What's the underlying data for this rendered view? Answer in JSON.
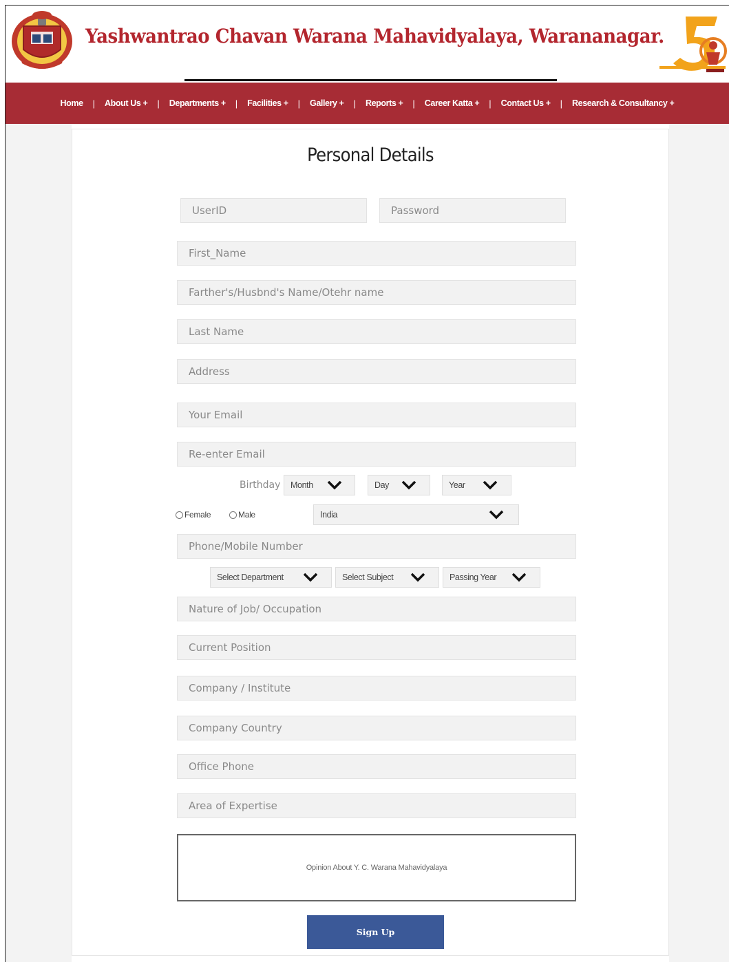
{
  "header": {
    "title": "Yashwantrao Chavan Warana Mahavidyalaya, Warananagar.",
    "colors": {
      "brand_red": "#a72c35",
      "title_red": "#b3262e",
      "button_blue": "#3b5998"
    }
  },
  "nav": {
    "items": [
      {
        "label": "Home"
      },
      {
        "label": "About Us +"
      },
      {
        "label": "Departments +"
      },
      {
        "label": "Facilities +"
      },
      {
        "label": "Gallery +"
      },
      {
        "label": "Reports +"
      },
      {
        "label": "Career Katta +"
      },
      {
        "label": "Contact Us +"
      },
      {
        "label": "Research & Consultancy +"
      }
    ],
    "separator": "|"
  },
  "form": {
    "title": "Personal Details",
    "userid_placeholder": "UserID",
    "password_placeholder": "Password",
    "first_name_placeholder": "First_Name",
    "middle_name_placeholder": "Farther's/Husbnd's Name/Otehr name",
    "last_name_placeholder": "Last Name",
    "address_placeholder": "Address",
    "email_placeholder": "Your Email",
    "reemail_placeholder": "Re-enter Email",
    "birthday_label": "Birthday",
    "month_select": "Month",
    "day_select": "Day",
    "year_select": "Year",
    "gender_female": "Female",
    "gender_male": "Male",
    "country_select": "India",
    "phone_placeholder": "Phone/Mobile Number",
    "department_select": "Select Department",
    "subject_select": "Select Subject",
    "passing_year_select": "Passing Year",
    "occupation_placeholder": "Nature of Job/ Occupation",
    "position_placeholder": "Current Position",
    "company_placeholder": "Company / Institute",
    "company_country_placeholder": "Company Country",
    "office_phone_placeholder": "Office Phone",
    "expertise_placeholder": "Area of Expertise",
    "opinion_placeholder": "Opinion About Y. C. Warana Mahavidyalaya",
    "signup_label": "Sign Up"
  },
  "icons": {
    "left_logo": "college-emblem-icon",
    "right_logo": "fifty-years-anniversary-icon",
    "dropdown": "chevron-down-icon"
  }
}
